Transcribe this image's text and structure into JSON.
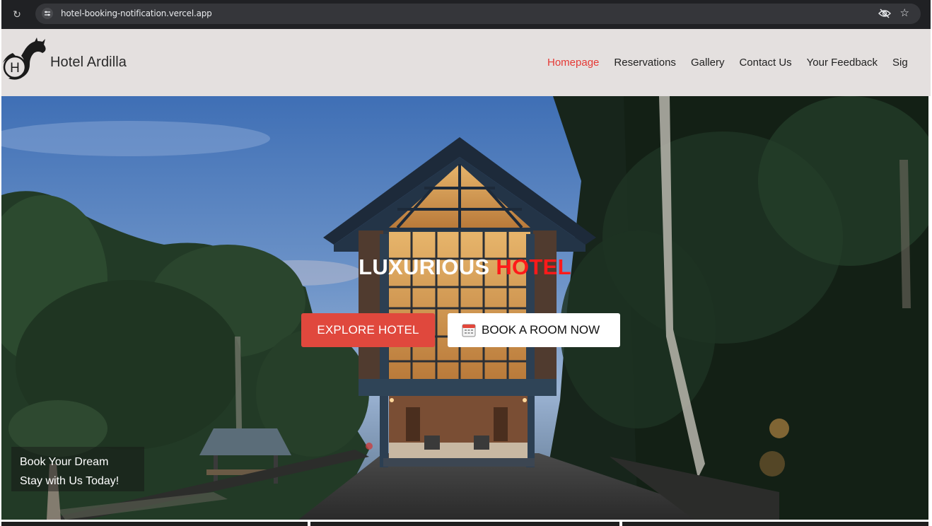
{
  "browser": {
    "url": "hotel-booking-notification.vercel.app"
  },
  "site": {
    "brand": "Hotel Ardilla",
    "logo_letter": "H",
    "nav": [
      {
        "label": "Homepage",
        "active": true
      },
      {
        "label": "Reservations",
        "active": false
      },
      {
        "label": "Gallery",
        "active": false
      },
      {
        "label": "Contact Us",
        "active": false
      },
      {
        "label": "Your Feedback",
        "active": false
      },
      {
        "label": "Sig",
        "active": false
      }
    ]
  },
  "hero": {
    "title_white": "LUXURIOUS ",
    "title_red": "HOTEL",
    "explore_label": "EXPLORE HOTEL",
    "book_label": "BOOK A ROOM NOW",
    "promo_line1": "Book Your Dream",
    "promo_line2": "Stay with Us Today!"
  },
  "colors": {
    "accent": "#e0483d",
    "active_nav": "#e53935",
    "navbar_bg": "#e4e0df"
  },
  "icons": {
    "reload": "reload-icon",
    "site_settings": "tune-icon",
    "hide_eye": "eye-off-icon",
    "bookmark": "star-icon",
    "calendar": "calendar-icon"
  }
}
